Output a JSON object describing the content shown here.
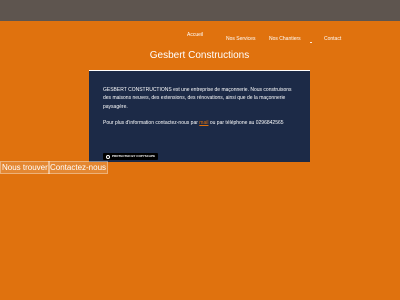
{
  "nav": {
    "items": [
      {
        "label": "Accueil"
      },
      {
        "label": "Nos Services"
      },
      {
        "label": "Nos Chantiers"
      },
      {
        "label": "Contact"
      }
    ]
  },
  "card": {
    "title": "Gesbert Constructions",
    "intro": "GESBERT CONSTRUCTIONS est une entreprise de maçonnerie. Nous construisons des maisons neuves, des extensions, des rénovations, ainsi que de la maçonnerie paysagère.",
    "contact_prefix": "Pour plus d'information contactez-nous par",
    "contact_link": "mail",
    "contact_suffix": "ou par téléphone au",
    "phone": "0296842565",
    "badge": "PROTECTED BY COPYSCAPE"
  },
  "side": {
    "find_us": "Nous trouver",
    "contact_us": "Contactez-nous"
  },
  "colors": {
    "background": "#e0720e",
    "topbar": "#5e554f",
    "panel": "#1c2a47"
  }
}
